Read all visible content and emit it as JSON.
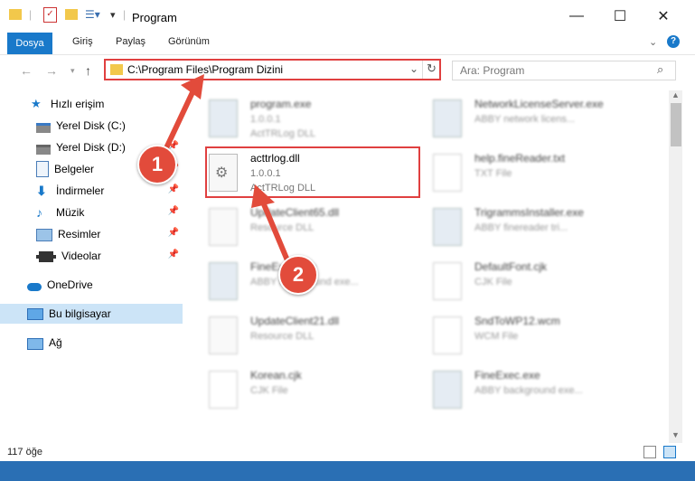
{
  "window": {
    "title": "Program"
  },
  "ribbon": {
    "tabs": [
      "Dosya",
      "Giriş",
      "Paylaş",
      "Görünüm"
    ]
  },
  "address": {
    "path": "C:\\Program Files\\Program Dizini"
  },
  "search": {
    "placeholder": "Ara: Program"
  },
  "sidebar": {
    "items": [
      {
        "label": "Hızlı erişim",
        "icon": "star-icon"
      },
      {
        "label": "Yerel Disk (C:)",
        "icon": "drive-icon"
      },
      {
        "label": "Yerel Disk (D:)",
        "icon": "drive-icon"
      },
      {
        "label": "Belgeler",
        "icon": "documents-icon"
      },
      {
        "label": "İndirmeler",
        "icon": "download-icon"
      },
      {
        "label": "Müzik",
        "icon": "music-icon"
      },
      {
        "label": "Resimler",
        "icon": "pictures-icon"
      },
      {
        "label": "Videolar",
        "icon": "video-icon"
      },
      {
        "label": "OneDrive",
        "icon": "cloud-icon"
      },
      {
        "label": "Bu bilgisayar",
        "icon": "computer-icon"
      },
      {
        "label": "Ağ",
        "icon": "network-icon"
      }
    ]
  },
  "files": [
    {
      "name": "program.exe",
      "line1": "1.0.0.1",
      "line2": "ActTRLog DLL"
    },
    {
      "name": "NetworkLicenseServer.exe",
      "line1": "ABBY network licens...",
      "line2": ""
    },
    {
      "name": "acttrlog.dll",
      "line1": "1.0.0.1",
      "line2": "ActTRLog DLL"
    },
    {
      "name": "help.fineReader.txt",
      "line1": "TXT File",
      "line2": ""
    },
    {
      "name": "UpdateClient65.dll",
      "line1": "Resource DLL",
      "line2": ""
    },
    {
      "name": "TrigrammsInstaller.exe",
      "line1": "ABBY finereader tri...",
      "line2": ""
    },
    {
      "name": "FineExec.exe",
      "line1": "ABBY background exe...",
      "line2": ""
    },
    {
      "name": "DefaultFont.cjk",
      "line1": "CJK File",
      "line2": ""
    },
    {
      "name": "UpdateClient21.dll",
      "line1": "Resource DLL",
      "line2": ""
    },
    {
      "name": "SndToWP12.wcm",
      "line1": "WCM File",
      "line2": ""
    },
    {
      "name": "Korean.cjk",
      "line1": "CJK File",
      "line2": ""
    },
    {
      "name": "FineExec.exe",
      "line1": "ABBY background exe...",
      "line2": ""
    }
  ],
  "status": {
    "count": "117 öğe"
  },
  "annotations": {
    "badge1": "1",
    "badge2": "2"
  },
  "colors": {
    "accent": "#1979ca",
    "annotation": "#e24b3b",
    "selection": "#cce4f7"
  }
}
